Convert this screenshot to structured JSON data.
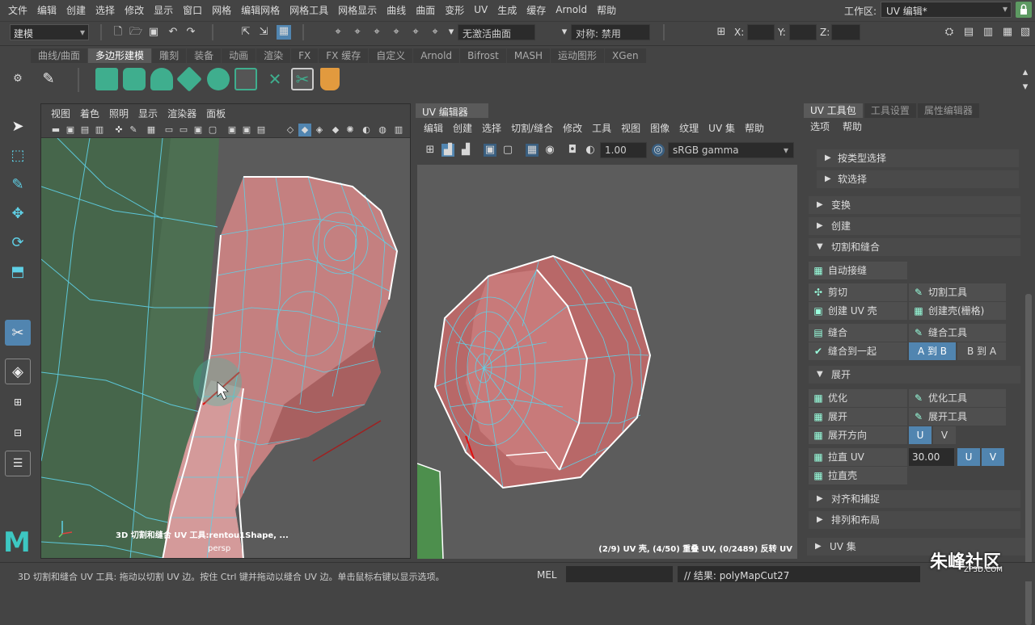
{
  "menubar": {
    "items": [
      "文件",
      "编辑",
      "创建",
      "选择",
      "修改",
      "显示",
      "窗口",
      "网格",
      "编辑网格",
      "网格工具",
      "网格显示",
      "曲线",
      "曲面",
      "变形",
      "UV",
      "生成",
      "缓存",
      "Arnold",
      "帮助"
    ],
    "workspace_label": "工作区:",
    "workspace_value": "UV 编辑*"
  },
  "statusline": {
    "mode": "建模",
    "live_surface": "无激活曲面",
    "symmetry": "对称: 禁用",
    "x_label": "X:",
    "y_label": "Y:",
    "z_label": "Z:"
  },
  "shelf": {
    "tabs": [
      "曲线/曲面",
      "多边形建模",
      "雕刻",
      "装备",
      "动画",
      "渲染",
      "FX",
      "FX 缓存",
      "自定义",
      "Arnold",
      "Bifrost",
      "MASH",
      "运动图形",
      "XGen"
    ],
    "active_tab": "多边形建模"
  },
  "viewport": {
    "menu": [
      "视图",
      "着色",
      "照明",
      "显示",
      "渲染器",
      "面板"
    ],
    "tool_label": "3D 切割和缝合 UV 工具:rentou1Shape, ...",
    "camera": "persp"
  },
  "uv_editor": {
    "title": "UV 编辑器",
    "menu": [
      "编辑",
      "创建",
      "选择",
      "切割/缝合",
      "修改",
      "工具",
      "视图",
      "图像",
      "纹理",
      "UV 集",
      "帮助"
    ],
    "exposure": "1.00",
    "color_space": "sRGB gamma",
    "stats": "(2/9) UV 壳, (4/50) 重叠 UV, (0/2489) 反转 UV"
  },
  "right_panel": {
    "tabs": [
      "UV 工具包",
      "工具设置",
      "属性编辑器"
    ],
    "active_tab": "UV 工具包",
    "menu": [
      "选项",
      "帮助"
    ],
    "sub_sections": [
      "按类型选择",
      "软选择"
    ],
    "sections": {
      "transform": "变换",
      "create": "创建",
      "cut_sew": "切割和缝合",
      "unfold": "展开",
      "align": "对齐和捕捉",
      "arrange": "排列和布局",
      "uv_sets": "UV 集"
    },
    "cut_sew": {
      "auto_seams": "自动接缝",
      "cut": "剪切",
      "cut_tool": "切割工具",
      "create_shell": "创建 UV 壳",
      "create_shell_grid": "创建壳(栅格)",
      "sew": "缝合",
      "sew_tool": "缝合工具",
      "move_sew": "缝合到一起",
      "a_to_b": "A 到 B",
      "b_to_a": "B 到 A"
    },
    "unfold": {
      "optimize": "优化",
      "optimize_tool": "优化工具",
      "unfold": "展开",
      "unfold_tool": "展开工具",
      "unfold_along": "展开方向",
      "u": "U",
      "v": "V",
      "straighten_uv": "拉直 UV",
      "straighten_value": "30.00",
      "straighten_shell": "拉直壳"
    }
  },
  "footer": {
    "help": "3D 切割和缝合 UV 工具: 拖动以切割 UV 边。按住 Ctrl 键并拖动以缝合 UV 边。单击鼠标右键以显示选项。",
    "mel": "MEL",
    "result": "// 结果: polyMapCut27"
  },
  "watermark": {
    "main": "朱峰社区",
    "sub": "ZF3D.COM"
  },
  "colors": {
    "mesh_fill": "#c96a6a",
    "wire": "#5fd0e6",
    "bg_green": "#4d6f52",
    "accent_blue": "#5185b0"
  }
}
